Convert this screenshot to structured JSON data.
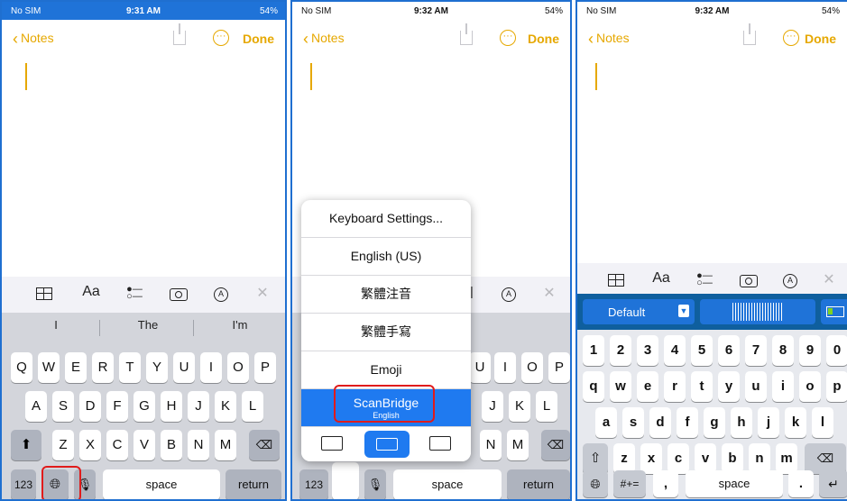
{
  "panels": [
    {
      "status": {
        "carrier": "No SIM",
        "time": "9:31 AM",
        "battery": "54%"
      },
      "nav": {
        "back": "Notes",
        "done": "Done"
      },
      "toolbar": {
        "format": "Aa"
      },
      "suggestions": [
        "I",
        "The",
        "I'm"
      ],
      "rows": [
        [
          "Q",
          "W",
          "E",
          "R",
          "T",
          "Y",
          "U",
          "I",
          "O",
          "P"
        ],
        [
          "A",
          "S",
          "D",
          "F",
          "G",
          "H",
          "J",
          "K",
          "L"
        ],
        [
          "Z",
          "X",
          "C",
          "V",
          "B",
          "N",
          "M"
        ]
      ],
      "bottom": {
        "num": "123",
        "space": "space",
        "return": "return"
      }
    },
    {
      "status": {
        "carrier": "No SIM",
        "time": "9:32 AM",
        "battery": "54%"
      },
      "nav": {
        "back": "Notes",
        "done": "Done"
      },
      "menu": [
        "Keyboard Settings...",
        "English (US)",
        "繁體注音",
        "繁體手寫",
        "Emoji"
      ],
      "menu_selected": {
        "title": "ScanBridge",
        "subtitle": "English"
      },
      "partial_rows": [
        [
          "U",
          "I",
          "O",
          "P"
        ],
        [
          "J",
          "K",
          "L"
        ],
        [
          "N",
          "M"
        ]
      ],
      "bottom": {
        "num": "123",
        "space": "space",
        "return": "return"
      }
    },
    {
      "status": {
        "carrier": "No SIM",
        "time": "9:32 AM",
        "battery": "54%"
      },
      "nav": {
        "back": "Notes",
        "done": "Done"
      },
      "toolbar": {
        "format": "Aa"
      },
      "scan_bar": {
        "dropdown": "Default"
      },
      "rows": [
        [
          "1",
          "2",
          "3",
          "4",
          "5",
          "6",
          "7",
          "8",
          "9",
          "0"
        ],
        [
          "q",
          "w",
          "e",
          "r",
          "t",
          "y",
          "u",
          "i",
          "o",
          "p"
        ],
        [
          "a",
          "s",
          "d",
          "f",
          "g",
          "h",
          "j",
          "k",
          "l"
        ],
        [
          "z",
          "x",
          "c",
          "v",
          "b",
          "n",
          "m"
        ]
      ],
      "bottom": {
        "sym": "#+=",
        "comma": ",",
        "space": "space",
        "period": "."
      }
    }
  ],
  "colors": {
    "accent": "#e6a800",
    "selection": "#1f7af0",
    "highlight": "#e01b1b",
    "border": "#1f6fd0"
  }
}
